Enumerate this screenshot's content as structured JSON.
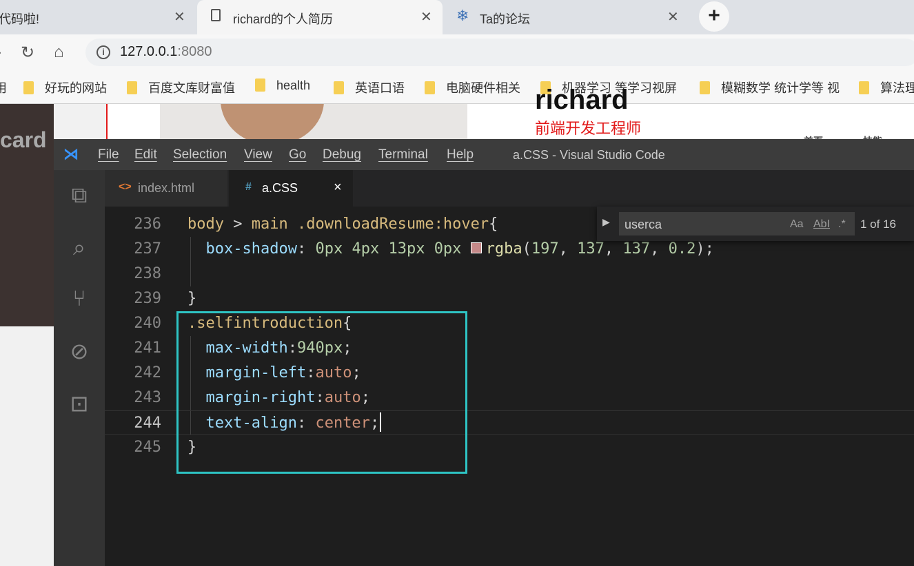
{
  "browser": {
    "tabs": [
      {
        "title": "代码啦!"
      },
      {
        "title": "richard的个人简历"
      },
      {
        "title": "Ta的论坛"
      }
    ],
    "url_host": "127.0.0.1",
    "url_port": ":8080",
    "bookmarks": [
      {
        "label": "用"
      },
      {
        "label": "好玩的网站"
      },
      {
        "label": "百度文库财富值"
      },
      {
        "label": "health"
      },
      {
        "label": "英语口语"
      },
      {
        "label": "电脑硬件相关"
      },
      {
        "label": "机器学习 等学习视屏"
      },
      {
        "label": "模糊数学 统计学等 视"
      },
      {
        "label": "算法理"
      }
    ]
  },
  "webpage": {
    "side_label": "card",
    "name": "richard",
    "job_title": "前端开发工程师",
    "nav": [
      "首页",
      "技能"
    ]
  },
  "vscode": {
    "menu": [
      "File",
      "Edit",
      "Selection",
      "View",
      "Go",
      "Debug",
      "Terminal",
      "Help"
    ],
    "window_title": "a.CSS - Visual Studio Code",
    "editor_tabs": [
      {
        "icon": "<>",
        "label": "index.html",
        "active": false
      },
      {
        "icon": "#",
        "label": "a.CSS",
        "active": true,
        "close": "×"
      }
    ],
    "find": {
      "query": "userca",
      "match_case": "Aa",
      "whole_word": "AbI",
      "regex": ".*",
      "count": "1 of 16"
    },
    "lines": [
      {
        "n": "236",
        "tokens": [
          [
            "t-sel",
            "body"
          ],
          [
            "t-op",
            " > "
          ],
          [
            "t-sel",
            "main"
          ],
          [
            "t-op",
            " "
          ],
          [
            "t-sel",
            ".downloadResume:hover"
          ],
          [
            "t-op",
            "{"
          ]
        ]
      },
      {
        "n": "237",
        "tokens": [
          [
            "t-op",
            "  "
          ],
          [
            "t-prop",
            "box-shadow"
          ],
          [
            "t-op",
            ": "
          ],
          [
            "t-num",
            "0px"
          ],
          [
            "t-op",
            " "
          ],
          [
            "t-num",
            "4px"
          ],
          [
            "t-op",
            " "
          ],
          [
            "t-num",
            "13px"
          ],
          [
            "t-op",
            " "
          ],
          [
            "t-num",
            "0px"
          ],
          [
            "t-op",
            " "
          ],
          [
            "swatch",
            "#c58989"
          ],
          [
            "t-fn",
            "rgba"
          ],
          [
            "t-op",
            "("
          ],
          [
            "t-num",
            "197"
          ],
          [
            "t-op",
            ", "
          ],
          [
            "t-num",
            "137"
          ],
          [
            "t-op",
            ", "
          ],
          [
            "t-num",
            "137"
          ],
          [
            "t-op",
            ", "
          ],
          [
            "t-num",
            "0.2"
          ],
          [
            "t-op",
            ");"
          ]
        ]
      },
      {
        "n": "238",
        "tokens": []
      },
      {
        "n": "239",
        "tokens": [
          [
            "t-op",
            "}"
          ]
        ]
      },
      {
        "n": "240",
        "tokens": [
          [
            "t-sel",
            ".selfintroduction"
          ],
          [
            "t-op",
            "{"
          ]
        ]
      },
      {
        "n": "241",
        "tokens": [
          [
            "t-op",
            "  "
          ],
          [
            "t-prop",
            "max-width"
          ],
          [
            "t-op",
            ":"
          ],
          [
            "t-num",
            "940px"
          ],
          [
            "t-op",
            ";"
          ]
        ]
      },
      {
        "n": "242",
        "tokens": [
          [
            "t-op",
            "  "
          ],
          [
            "t-prop",
            "margin-left"
          ],
          [
            "t-op",
            ":"
          ],
          [
            "t-str",
            "auto"
          ],
          [
            "t-op",
            ";"
          ]
        ]
      },
      {
        "n": "243",
        "tokens": [
          [
            "t-op",
            "  "
          ],
          [
            "t-prop",
            "margin-right"
          ],
          [
            "t-op",
            ":"
          ],
          [
            "t-str",
            "auto"
          ],
          [
            "t-op",
            ";"
          ]
        ]
      },
      {
        "n": "244",
        "active": true,
        "tokens": [
          [
            "t-op",
            "  "
          ],
          [
            "t-prop",
            "text-align"
          ],
          [
            "t-op",
            ": "
          ],
          [
            "t-str",
            "center"
          ],
          [
            "t-op",
            ";"
          ],
          [
            "caret",
            ""
          ]
        ]
      },
      {
        "n": "245",
        "tokens": [
          [
            "t-op",
            "}"
          ]
        ]
      }
    ]
  },
  "colors": {
    "vscode_bg": "#1e1e1e",
    "highlight_box": "#2ec4c4",
    "accent_red": "#e21a1a",
    "folder": "#f6cf55"
  },
  "icons": [
    "page-icon",
    "snowflake-icon",
    "back-icon",
    "reload-icon",
    "home-icon",
    "info-icon",
    "folder-icon",
    "vscode-logo-icon",
    "explorer-icon",
    "search-icon",
    "source-control-icon",
    "debug-icon",
    "extensions-icon",
    "html-file-icon",
    "css-file-icon",
    "close-icon",
    "expand-icon"
  ]
}
